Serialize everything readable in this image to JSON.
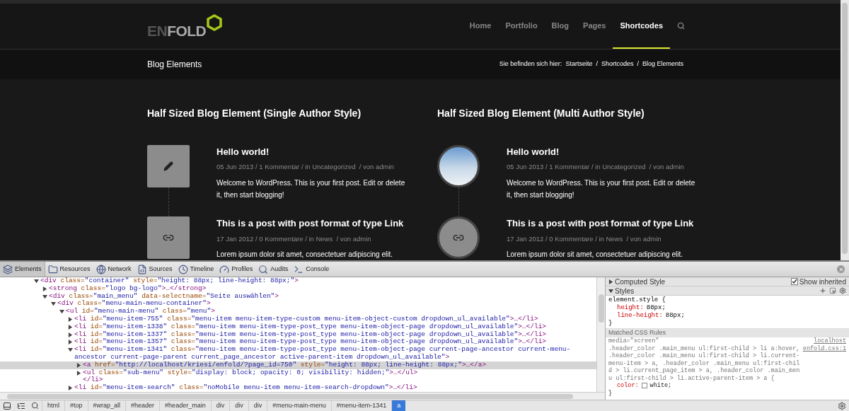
{
  "site": {
    "logo": {
      "part_1": "EN",
      "part_2": "FOLD"
    },
    "nav": [
      {
        "label": "Home",
        "selected": false
      },
      {
        "label": "Portfolio",
        "selected": false
      },
      {
        "label": "Blog",
        "selected": false
      },
      {
        "label": "Pages",
        "selected": false
      },
      {
        "label": "Shortcodes",
        "selected": true
      }
    ],
    "page_title": "Blog Elements",
    "breadcrumb": {
      "prefix": "Sie befinden sich hier:",
      "items": [
        "Startseite",
        "/",
        "Shortcodes",
        "/",
        "Blog Elements"
      ]
    },
    "columns": [
      {
        "heading": "Half Sized Blog Element (Single Author Style)",
        "posts": [
          {
            "kind": "square-pencil",
            "title": "Hello world!",
            "meta": "05 Jun 2013 / 1 Kommentar / in Uncategorized  / von admin",
            "excerpt": "Welcome to WordPress. This is your first post. Edit or delete it, then start blogging!"
          },
          {
            "kind": "square-link",
            "title": "This is a post with post format of type Link",
            "meta": "17 Jan 2012 / 0 Kommentare / in News  / von admin",
            "excerpt": "Lorem ipsum dolor sit amet, consectetuer adipiscing elit."
          }
        ]
      },
      {
        "heading": "Half Sized Blog Element (Multi Author Style)",
        "posts": [
          {
            "kind": "circle-photo",
            "title": "Hello world!",
            "meta": "05 Jun 2013 / 1 Kommentar / in Uncategorized  / von admin",
            "excerpt": "Welcome to WordPress. This is your first post. Edit or delete it, then start blogging!"
          },
          {
            "kind": "circle-link",
            "title": "This is a post with post format of type Link",
            "meta": "17 Jan 2012 / 0 Kommentare / in News  / von admin",
            "excerpt": "Lorem ipsum dolor sit amet, consectetuer adipiscing elit."
          }
        ]
      }
    ]
  },
  "devtools": {
    "tabs": [
      {
        "label": "Elements",
        "selected": true
      },
      {
        "label": "Resources",
        "selected": false
      },
      {
        "label": "Network",
        "selected": false
      },
      {
        "label": "Sources",
        "selected": false
      },
      {
        "label": "Timeline",
        "selected": false
      },
      {
        "label": "Profiles",
        "selected": false
      },
      {
        "label": "Audits",
        "selected": false
      },
      {
        "label": "Console",
        "selected": false
      }
    ],
    "dom": {
      "text": "<div class=\"container\" style=\"height: 88px; line-height: 88px;\">",
      "expanded": true,
      "selected": false,
      "children": [
        {
          "text": "<strong class=\"logo bg-logo\">…</strong>",
          "expanded": false,
          "selected": false
        },
        {
          "text": "<div class=\"main_menu\" data-selectname=\"Seite auswählen\">",
          "expanded": true,
          "selected": false,
          "children": [
            {
              "text": "<div class=\"menu-main-menu-container\">",
              "expanded": true,
              "selected": false,
              "children": [
                {
                  "text": "<ul id=\"menu-main-menu\" class=\"menu\">",
                  "expanded": true,
                  "selected": false,
                  "children": [
                    {
                      "text": "<li id=\"menu-item-755\" class=\"menu-item menu-item-type-custom menu-item-object-custom dropdown_ul_available\">…</li>",
                      "expanded": false,
                      "selected": false
                    },
                    {
                      "text": "<li id=\"menu-item-1338\" class=\"menu-item menu-item-type-post_type menu-item-object-page dropdown_ul_available\">…</li>",
                      "expanded": false,
                      "selected": false
                    },
                    {
                      "text": "<li id=\"menu-item-1337\" class=\"menu-item menu-item-type-post_type menu-item-object-page dropdown_ul_available\">…</li>",
                      "expanded": false,
                      "selected": false
                    },
                    {
                      "text": "<li id=\"menu-item-1357\" class=\"menu-item menu-item-type-post_type menu-item-object-page dropdown_ul_available\">…</li>",
                      "expanded": false,
                      "selected": false
                    },
                    {
                      "text": "<li id=\"menu-item-1341\" class=\"menu-item menu-item-type-post_type menu-item-object-page current-page-ancestor current-menu-ancestor current-page-parent current_page_ancestor active-parent-item dropdown_ul_available\">",
                      "expanded": true,
                      "selected": false,
                      "children": [
                        {
                          "text": "<a href=\"http://localhost/kriesi/enfold/?page_id=750\" style=\"height: 88px; line-height: 88px;\">…</a>",
                          "expanded": false,
                          "selected": true
                        },
                        {
                          "text": "<ul class=\"sub-menu\" style=\"display: block; opacity: 0; visibility: hidden;\">…</ul>",
                          "expanded": false,
                          "selected": false
                        },
                        {
                          "kind": "close",
                          "text": "</li>",
                          "selected": false
                        }
                      ]
                    },
                    {
                      "text": "<li id=\"menu-item-search\" class=\"noMobile menu-item menu-item-search-dropdown\">…</li>",
                      "expanded": false,
                      "selected": false
                    }
                  ]
                }
              ]
            }
          ]
        }
      ]
    },
    "styles": {
      "computed": {
        "label": "Computed Style",
        "expanded": false,
        "show_inherited": {
          "label": "Show inherited",
          "checked": true
        }
      },
      "styles_header": {
        "label": "Styles",
        "expanded": true
      },
      "element_style": {
        "selector": "element.style {",
        "props": [
          {
            "name": "height:",
            "value": "88px;"
          },
          {
            "name": "line-height:",
            "value": "88px;"
          }
        ],
        "close": "}"
      },
      "matched_header": "Matched CSS Rules",
      "rule": {
        "media": "media=\"screen\"",
        "source": "localhost",
        "file": "enfold.css:1",
        "selector": ".header_color .main_menu ul:first-child > li a:hover, .header_color .main_menu ul:first-child > li.current-menu-item > a, .header_color .main_menu ul:first-child > li.current_page_item > a, .header_color .main_menu ul:first-child > li.active-parent-item > a {",
        "props": [
          {
            "name": "color:",
            "value": "white;"
          }
        ],
        "close": "}"
      }
    },
    "crumbs": [
      {
        "label": "html",
        "selected": false
      },
      {
        "label": "#top",
        "selected": false
      },
      {
        "label": "#wrap_all",
        "selected": false
      },
      {
        "label": "#header",
        "selected": false
      },
      {
        "label": "#header_main",
        "selected": false
      },
      {
        "label": "div",
        "selected": false
      },
      {
        "label": "div",
        "selected": false
      },
      {
        "label": "div",
        "selected": false
      },
      {
        "label": "#menu-main-menu",
        "selected": false
      },
      {
        "label": "#menu-item-1341",
        "selected": false
      },
      {
        "label": "a",
        "selected": true
      }
    ]
  }
}
